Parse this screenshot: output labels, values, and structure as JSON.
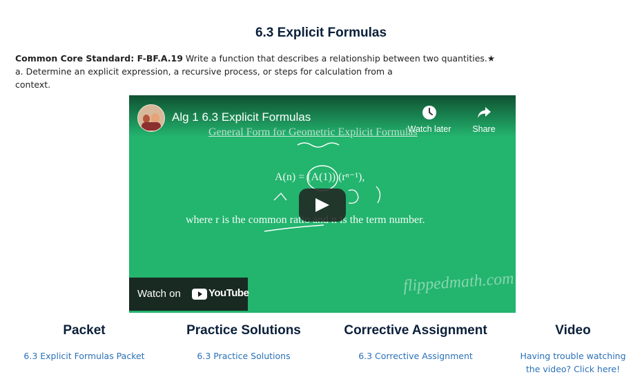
{
  "page": {
    "title": "6.3 Explicit Formulas"
  },
  "standard": {
    "label": "Common Core Standard: F-BF.A.19",
    "text_line1": "Write a function that describes a relationship between two quantities.★",
    "text_line2": "a. Determine an explicit expression, a recursive process, or steps for calculation from a",
    "text_line3": "context."
  },
  "video": {
    "title": "Alg 1 6.3 Explicit Formulas",
    "watch_later_label": "Watch later",
    "share_label": "Share",
    "board_heading": "General Form for Geometric Explicit Formulas",
    "board_formula": "A(n) = (A(1)) (rⁿ⁻¹),",
    "board_text": "where r is the common ratio and n is the term number.",
    "watermark": "flippedmath.com",
    "watch_on_label": "Watch on",
    "youtube_label": "YouTube",
    "accent": "#23b46e"
  },
  "sections": [
    {
      "heading": "Packet",
      "link": "6.3 Explicit Formulas Packet"
    },
    {
      "heading": "Practice Solutions",
      "link": "6.3 Practice Solutions"
    },
    {
      "heading": "Corrective Assignment",
      "link": "6.3 Corrective Assignment"
    },
    {
      "heading": "Video",
      "link_line1": "Having trouble watching",
      "link_line2": "the video?  Click here!"
    }
  ]
}
